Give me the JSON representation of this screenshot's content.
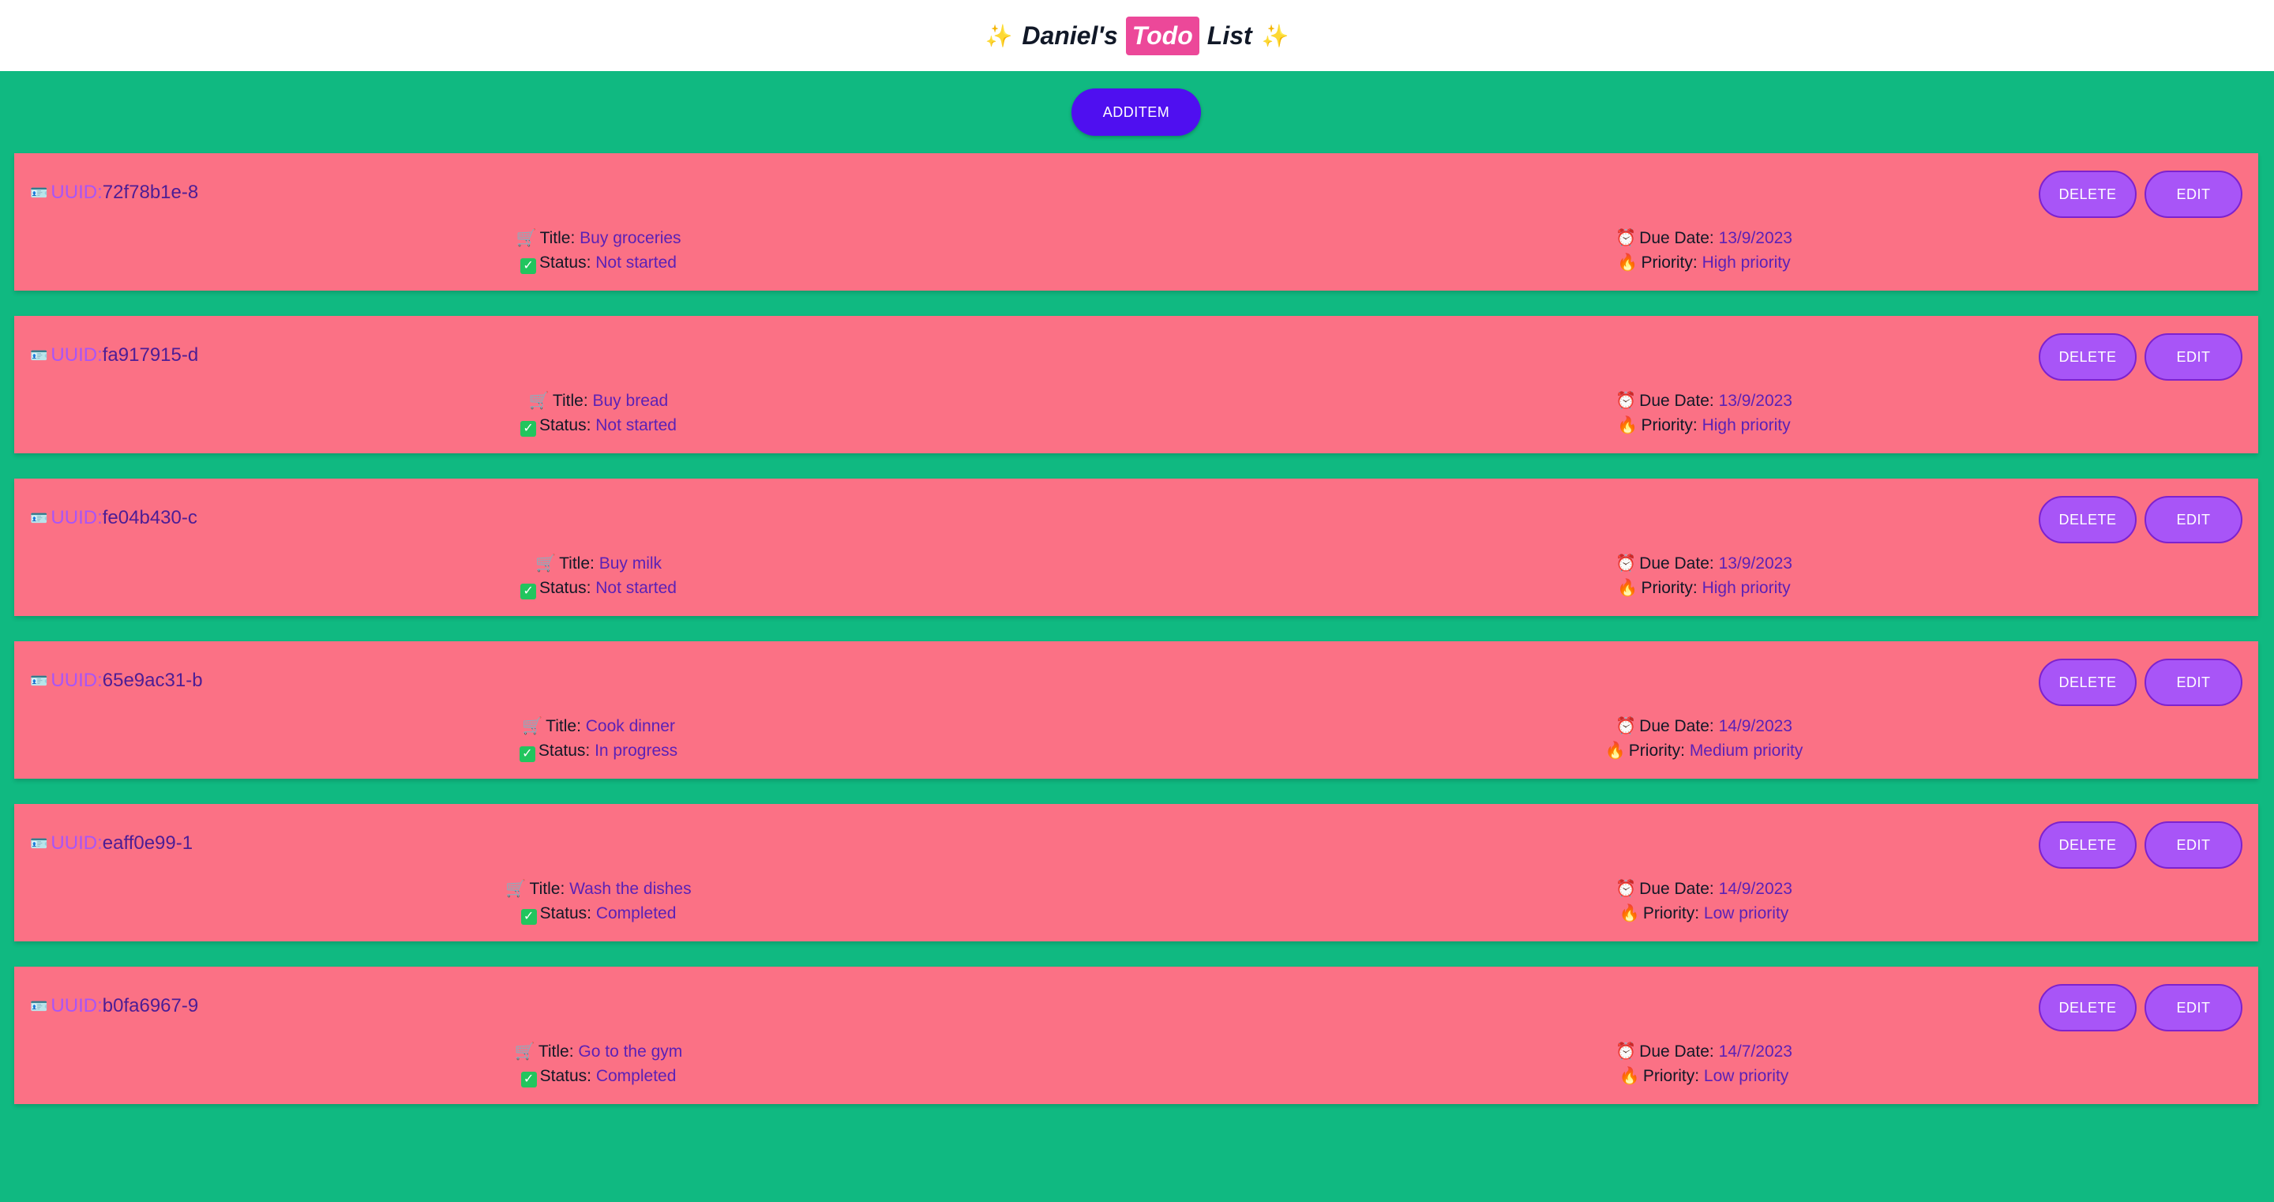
{
  "header": {
    "sparkle_left": "✨",
    "title_part1": "Daniel's",
    "title_highlight": "Todo",
    "title_part2": "List",
    "sparkle_right": "✨"
  },
  "toolbar": {
    "add_label": "ADDITEM"
  },
  "labels": {
    "uuid": "UUID:",
    "title": "Title:",
    "status": "Status:",
    "due": "Due Date:",
    "priority": "Priority:",
    "delete": "DELETE",
    "edit": "EDIT"
  },
  "icons": {
    "uuid": "id-card-icon",
    "title": "cart-icon",
    "status": "checkmark-icon",
    "due": "alarm-clock-icon",
    "priority": "fire-icon"
  },
  "colors": {
    "background": "#10b981",
    "card": "#fb7185",
    "add_button": "#4f0ff0",
    "action_button": "#a855f7",
    "highlight": "#ec4899"
  },
  "items": [
    {
      "uuid": "72f78b1e-8",
      "title": "Buy groceries",
      "status": "Not started",
      "due": "13/9/2023",
      "priority": "High priority"
    },
    {
      "uuid": "fa917915-d",
      "title": "Buy bread",
      "status": "Not started",
      "due": "13/9/2023",
      "priority": "High priority"
    },
    {
      "uuid": "fe04b430-c",
      "title": "Buy milk",
      "status": "Not started",
      "due": "13/9/2023",
      "priority": "High priority"
    },
    {
      "uuid": "65e9ac31-b",
      "title": "Cook dinner",
      "status": "In progress",
      "due": "14/9/2023",
      "priority": "Medium priority"
    },
    {
      "uuid": "eaff0e99-1",
      "title": "Wash the dishes",
      "status": "Completed",
      "due": "14/9/2023",
      "priority": "Low priority"
    },
    {
      "uuid": "b0fa6967-9",
      "title": "Go to the gym",
      "status": "Completed",
      "due": "14/7/2023",
      "priority": "Low priority"
    }
  ]
}
